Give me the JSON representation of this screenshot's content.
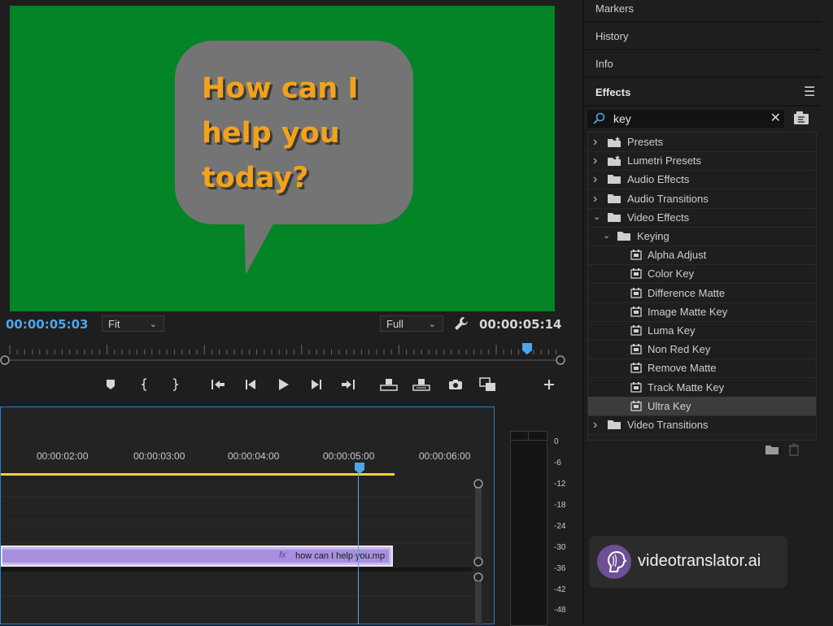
{
  "monitor": {
    "bubble_lines": [
      "How can I",
      "help you",
      "today?"
    ],
    "timecode_current": "00:00:05:03",
    "timecode_duration": "00:00:05:14",
    "fit_select": "Fit",
    "quality_select": "Full",
    "playhead_fraction": 0.94
  },
  "timeline": {
    "ruler_labels": [
      "00:00:02:00",
      "00:00:03:00",
      "00:00:04:00",
      "00:00:05:00",
      "00:00:06:00"
    ],
    "clip_label": "how can I help you.mp",
    "fx_badge": "fx"
  },
  "audio_meter": {
    "db_labels": [
      "0",
      "-6",
      "-12",
      "-18",
      "-24",
      "-30",
      "-36",
      "-42",
      "-48"
    ]
  },
  "panels": {
    "markers": "Markers",
    "history": "History",
    "info": "Info",
    "effects": "Effects"
  },
  "effects": {
    "search_value": "key",
    "tree": [
      {
        "label": "Presets",
        "kind": "preset-folder",
        "level": 0,
        "expanded": false
      },
      {
        "label": "Lumetri Presets",
        "kind": "preset-folder",
        "level": 0,
        "expanded": false
      },
      {
        "label": "Audio Effects",
        "kind": "folder",
        "level": 0,
        "expanded": false
      },
      {
        "label": "Audio Transitions",
        "kind": "folder",
        "level": 0,
        "expanded": false
      },
      {
        "label": "Video Effects",
        "kind": "folder",
        "level": 0,
        "expanded": true
      },
      {
        "label": "Keying",
        "kind": "folder",
        "level": 1,
        "expanded": true
      },
      {
        "label": "Alpha Adjust",
        "kind": "effect",
        "level": 2
      },
      {
        "label": "Color Key",
        "kind": "effect",
        "level": 2
      },
      {
        "label": "Difference Matte",
        "kind": "effect",
        "level": 2
      },
      {
        "label": "Image Matte Key",
        "kind": "effect",
        "level": 2
      },
      {
        "label": "Luma Key",
        "kind": "effect",
        "level": 2
      },
      {
        "label": "Non Red Key",
        "kind": "effect",
        "level": 2
      },
      {
        "label": "Remove Matte",
        "kind": "effect",
        "level": 2
      },
      {
        "label": "Track Matte Key",
        "kind": "effect",
        "level": 2
      },
      {
        "label": "Ultra Key",
        "kind": "effect",
        "level": 2,
        "selected": true
      },
      {
        "label": "Video Transitions",
        "kind": "folder",
        "level": 0,
        "expanded": false
      }
    ]
  },
  "watermark": {
    "brand_name": "videotranslator.ai"
  },
  "colors": {
    "accent_blue": "#4ea6ea",
    "chroma_green": "#038426",
    "bubble_gray": "#747474",
    "bubble_text": "#f3a21b",
    "clip_purple": "#a68fdc",
    "work_area_yellow": "#f0d43a"
  }
}
